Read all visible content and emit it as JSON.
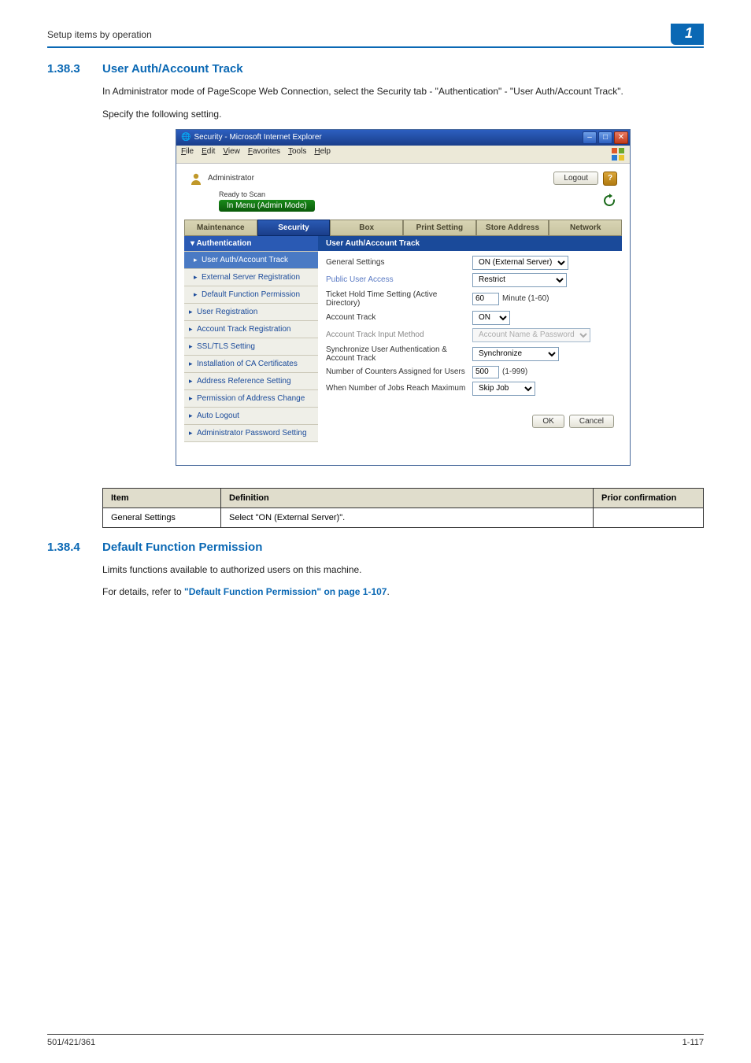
{
  "page_header": {
    "breadcrumb": "Setup items by operation",
    "chapter": "1"
  },
  "section1": {
    "number": "1.38.3",
    "title": "User Auth/Account Track",
    "para1": "In Administrator mode of PageScope Web Connection, select the Security tab - \"Authentication\" - \"User Auth/Account Track\".",
    "para2": "Specify the following setting."
  },
  "ie": {
    "title": "Security - Microsoft Internet Explorer",
    "menu": {
      "file": "File",
      "edit": "Edit",
      "view": "View",
      "favorites": "Favorites",
      "tools": "Tools",
      "help": "Help"
    },
    "admin_label": "Administrator",
    "logout": "Logout",
    "status_ready": "Ready to Scan",
    "mode_label": "In Menu (Admin Mode)",
    "tabs": {
      "maintenance": "Maintenance",
      "security": "Security",
      "box": "Box",
      "print": "Print Setting",
      "store": "Store Address",
      "network": "Network"
    },
    "sidebar": {
      "auth_head": "Authentication",
      "user_auth": "User Auth/Account Track",
      "ext_server": "External Server Registration",
      "default_func": "Default Function Permission",
      "user_reg": "User Registration",
      "acct_track_reg": "Account Track Registration",
      "ssl": "SSL/TLS Setting",
      "ca_cert": "Installation of CA Certificates",
      "addr_ref": "Address Reference Setting",
      "perm_addr": "Permission of Address Change",
      "auto_logout": "Auto Logout",
      "admin_pwd": "Administrator Password Setting"
    },
    "main": {
      "title": "User Auth/Account Track",
      "rows": {
        "gen": {
          "label": "General Settings",
          "value": "ON (External Server)"
        },
        "pub": {
          "label": "Public User Access",
          "value": "Restrict"
        },
        "ticket": {
          "label": "Ticket Hold Time Setting (Active Directory)",
          "value": "60",
          "hint": "Minute (1-60)"
        },
        "acct_track": {
          "label": "Account Track",
          "value": "ON"
        },
        "input_method": {
          "label": "Account Track Input Method",
          "value": "Account Name & Password"
        },
        "sync": {
          "label": "Synchronize User Authentication & Account Track",
          "value": "Synchronize"
        },
        "counters": {
          "label": "Number of Counters Assigned for Users",
          "value": "500",
          "hint": "(1-999)"
        },
        "jobs": {
          "label": "When Number of Jobs Reach Maximum",
          "value": "Skip Job"
        }
      },
      "ok": "OK",
      "cancel": "Cancel"
    }
  },
  "def_table": {
    "h1": "Item",
    "h2": "Definition",
    "h3": "Prior confirmation",
    "r1c1": "General Settings",
    "r1c2": "Select \"ON (External Server)\"."
  },
  "section2": {
    "number": "1.38.4",
    "title": "Default Function Permission",
    "para1": "Limits functions available to authorized users on this machine.",
    "para2a": "For details, refer to ",
    "para2b": "\"Default Function Permission\" on page 1-107",
    "para2c": "."
  },
  "footer": {
    "left": "501/421/361",
    "right": "1-117"
  }
}
